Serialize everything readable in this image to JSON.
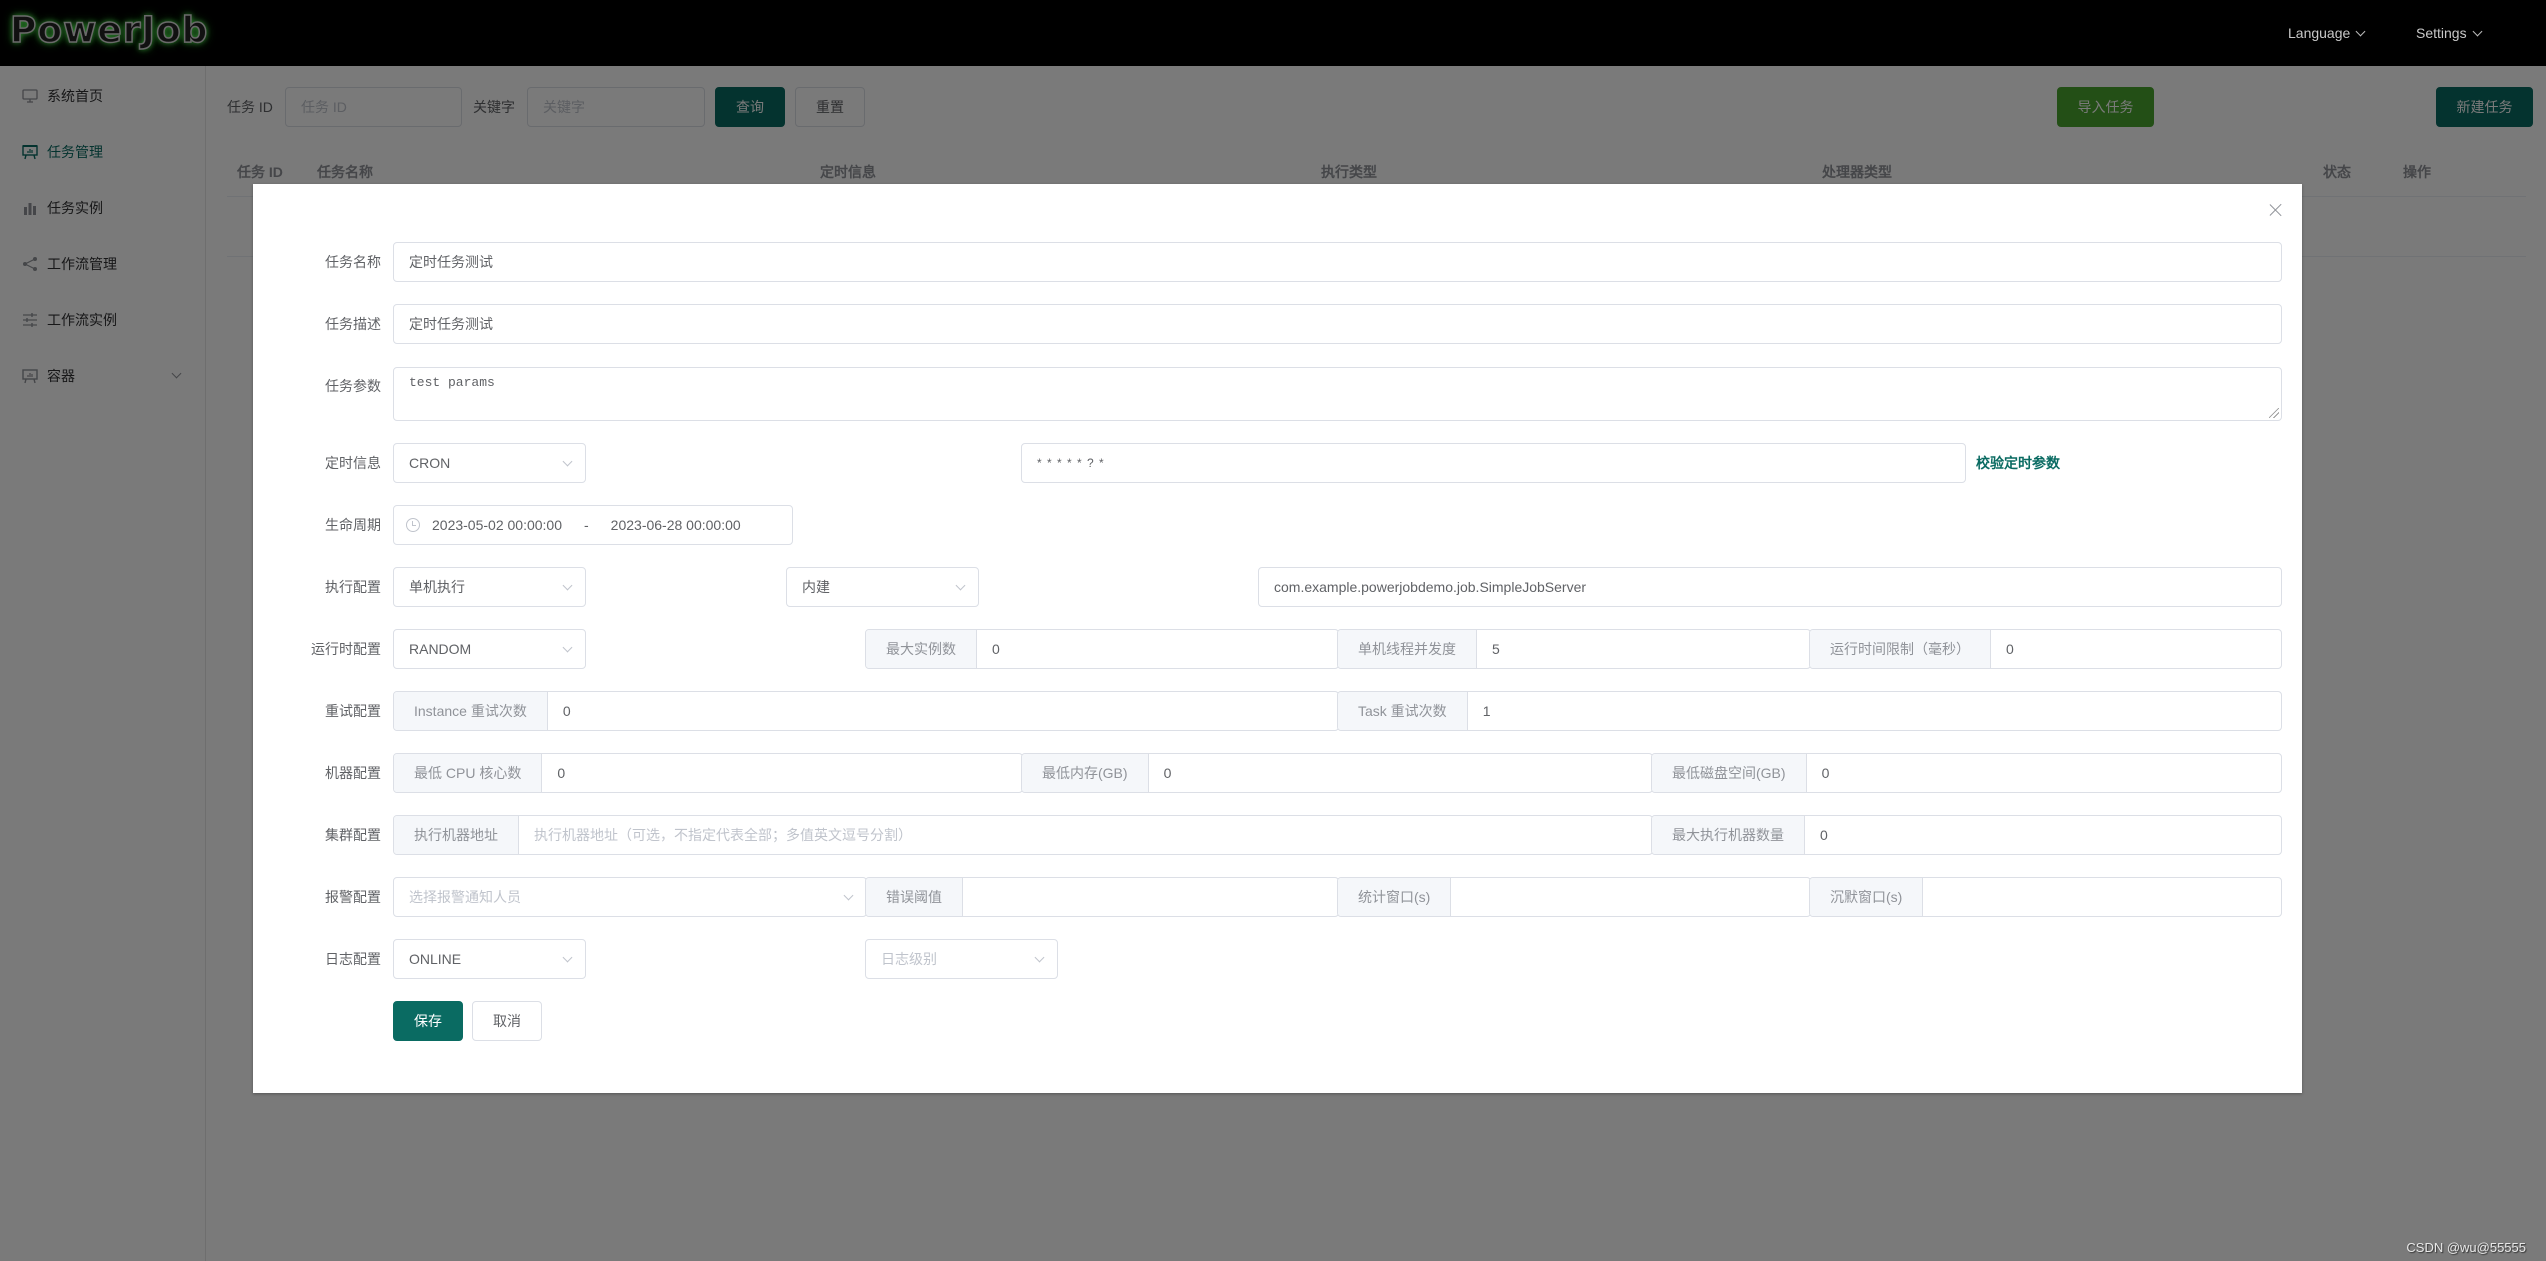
{
  "header": {
    "logo": "PowerJob",
    "menus": [
      {
        "label": "Language"
      },
      {
        "label": "Settings"
      }
    ]
  },
  "sidebar": {
    "items": [
      {
        "label": "系统首页",
        "icon": "monitor-icon",
        "active": false
      },
      {
        "label": "任务管理",
        "icon": "presentation-icon",
        "active": true
      },
      {
        "label": "任务实例",
        "icon": "bar-chart-icon",
        "active": false
      },
      {
        "label": "工作流管理",
        "icon": "share-icon",
        "active": false
      },
      {
        "label": "工作流实例",
        "icon": "sliders-icon",
        "active": false
      },
      {
        "label": "容器",
        "icon": "presentation-icon",
        "active": false,
        "expandable": true
      }
    ]
  },
  "query": {
    "task_id_label": "任务 ID",
    "task_id_placeholder": "任务 ID",
    "keyword_label": "关键字",
    "keyword_placeholder": "关键字",
    "search_button": "查询",
    "reset_button": "重置",
    "import_button": "导入任务",
    "new_button": "新建任务"
  },
  "table": {
    "columns": [
      "任务 ID",
      "任务名称",
      "定时信息",
      "执行类型",
      "处理器类型",
      "状态",
      "操作"
    ]
  },
  "modal": {
    "fields": {
      "job_name": {
        "label": "任务名称",
        "value": "定时任务测试"
      },
      "job_description": {
        "label": "任务描述",
        "value": "定时任务测试"
      },
      "job_params": {
        "label": "任务参数",
        "value": "test params"
      },
      "time_info": {
        "label": "定时信息",
        "type_value": "CRON",
        "expression": "* * * * * ? *",
        "validate_link": "校验定时参数"
      },
      "lifecycle": {
        "label": "生命周期",
        "start": "2023-05-02 00:00:00",
        "separator": "-",
        "end": "2023-06-28 00:00:00"
      },
      "execute": {
        "label": "执行配置",
        "execute_type": "单机执行",
        "processor_type": "内建",
        "processor_info": "com.example.powerjobdemo.job.SimpleJobServer"
      },
      "runtime": {
        "label": "运行时配置",
        "dispatch_strategy": "RANDOM",
        "max_instance_num": {
          "label": "最大实例数",
          "value": "0"
        },
        "concurrency": {
          "label": "单机线程并发度",
          "value": "5"
        },
        "time_limit": {
          "label": "运行时间限制（毫秒）",
          "value": "0"
        }
      },
      "retry": {
        "label": "重试配置",
        "instance_retry": {
          "label": "Instance 重试次数",
          "value": "0"
        },
        "task_retry": {
          "label": "Task 重试次数",
          "value": "1"
        }
      },
      "machine": {
        "label": "机器配置",
        "min_cpu": {
          "label": "最低 CPU 核心数",
          "value": "0"
        },
        "min_memory": {
          "label": "最低内存(GB)",
          "value": "0"
        },
        "min_disk": {
          "label": "最低磁盘空间(GB)",
          "value": "0"
        }
      },
      "cluster": {
        "label": "集群配置",
        "designated_workers": {
          "label": "执行机器地址",
          "placeholder": "执行机器地址（可选，不指定代表全部；多值英文逗号分割）"
        },
        "max_worker_count": {
          "label": "最大执行机器数量",
          "value": "0"
        }
      },
      "alarm": {
        "label": "报警配置",
        "notify_placeholder": "选择报警通知人员",
        "error_threshold": {
          "label": "错误阈值",
          "value": ""
        },
        "stat_window": {
          "label": "统计窗口(s)",
          "value": ""
        },
        "silence_window": {
          "label": "沉默窗口(s)",
          "value": ""
        }
      },
      "log": {
        "label": "日志配置",
        "type_value": "ONLINE",
        "level_placeholder": "日志级别"
      }
    },
    "save_button": "保存",
    "cancel_button": "取消"
  },
  "watermark": "CSDN @wu@55555",
  "colors": {
    "primary": "#0a6b62",
    "success": "#4aa52f",
    "header_bg": "#000000"
  }
}
